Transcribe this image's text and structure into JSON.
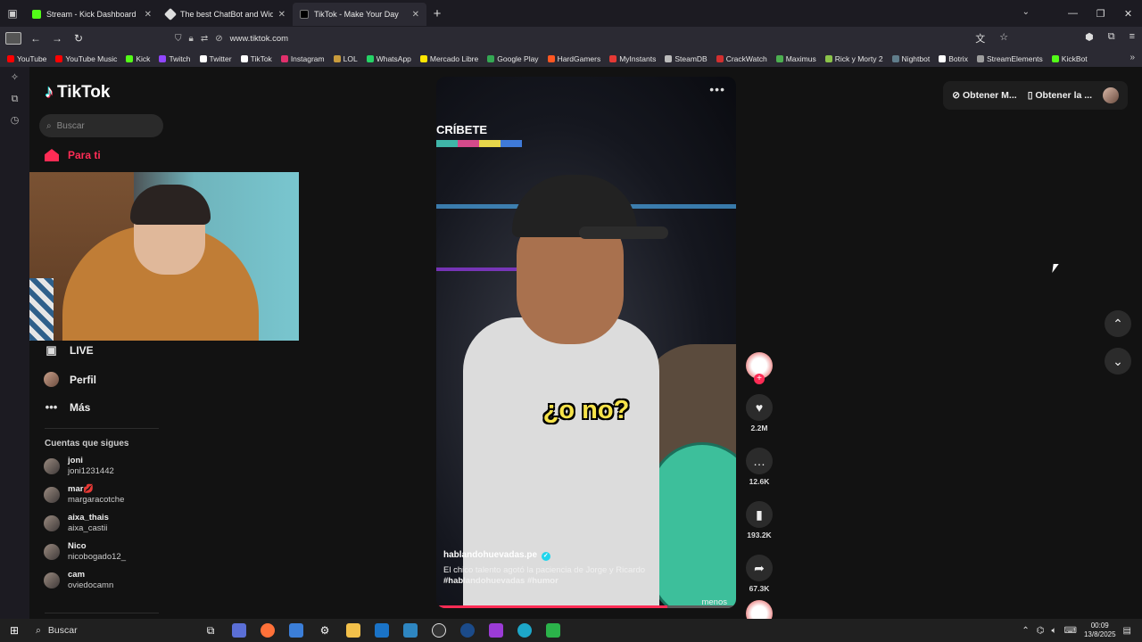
{
  "browser": {
    "tabs": [
      {
        "title": "Stream - Kick Dashboard",
        "color": "#53fc18"
      },
      {
        "title": "The best ChatBot and Widgets",
        "color": "#dddddd"
      },
      {
        "title": "TikTok - Make Your Day",
        "color": "#000000"
      }
    ],
    "url": "www.tiktok.com",
    "bookmarks": [
      {
        "label": "YouTube",
        "color": "#ff0000"
      },
      {
        "label": "YouTube Music",
        "color": "#ff0000"
      },
      {
        "label": "Kick",
        "color": "#53fc18"
      },
      {
        "label": "Twitch",
        "color": "#9146ff"
      },
      {
        "label": "Twitter",
        "color": "#ffffff"
      },
      {
        "label": "TikTok",
        "color": "#ffffff"
      },
      {
        "label": "Instagram",
        "color": "#e1306c"
      },
      {
        "label": "LOL",
        "color": "#c89b3c"
      },
      {
        "label": "WhatsApp",
        "color": "#25d366"
      },
      {
        "label": "Mercado Libre",
        "color": "#ffe600"
      },
      {
        "label": "Google Play",
        "color": "#34a853"
      },
      {
        "label": "HardGamers",
        "color": "#ff5722"
      },
      {
        "label": "MyInstants",
        "color": "#e53935"
      },
      {
        "label": "SteamDB",
        "color": "#bbbbbb"
      },
      {
        "label": "CrackWatch",
        "color": "#d32f2f"
      },
      {
        "label": "Maximus",
        "color": "#4caf50"
      },
      {
        "label": "Rick y Morty 2",
        "color": "#8bc34a"
      },
      {
        "label": "Nightbot",
        "color": "#607d8b"
      },
      {
        "label": "Botrix",
        "color": "#ffffff"
      },
      {
        "label": "StreamElements",
        "color": "#9e9e9e"
      },
      {
        "label": "KickBot",
        "color": "#53fc18"
      }
    ]
  },
  "tiktok": {
    "logo": "TikTok",
    "search_placeholder": "Buscar",
    "nav_for_you": "Para ti",
    "nav_live": "LIVE",
    "nav_profile": "Perfil",
    "nav_more": "Más",
    "following_title": "Cuentas que sigues",
    "following": [
      {
        "name": "joni",
        "handle": "joni1231442"
      },
      {
        "name": "mar💋",
        "handle": "margaracotche"
      },
      {
        "name": "aixa_thais",
        "handle": "aixa_castii"
      },
      {
        "name": "Nico",
        "handle": "nicobogado12_"
      },
      {
        "name": "cam",
        "handle": "oviedocamn"
      }
    ],
    "top_right": {
      "get_coins": "Obtener M...",
      "get_app": "Obtener la ..."
    },
    "video": {
      "banner_text": "CRÍBETE",
      "caption": "¿o no?",
      "author": "hablandohuevadas.pe",
      "description": "El chico talento agotó la paciencia de Jorge y Ricardo",
      "hashtags": "#hablandohuevadas  #humor",
      "less": "menos",
      "progress": 0.77
    },
    "actions": {
      "likes": "2.2M",
      "comments": "12.6K",
      "saves": "193.2K",
      "shares": "67.3K"
    }
  },
  "taskbar": {
    "search": "Buscar",
    "time": "00:09",
    "date": "13/8/2025"
  }
}
